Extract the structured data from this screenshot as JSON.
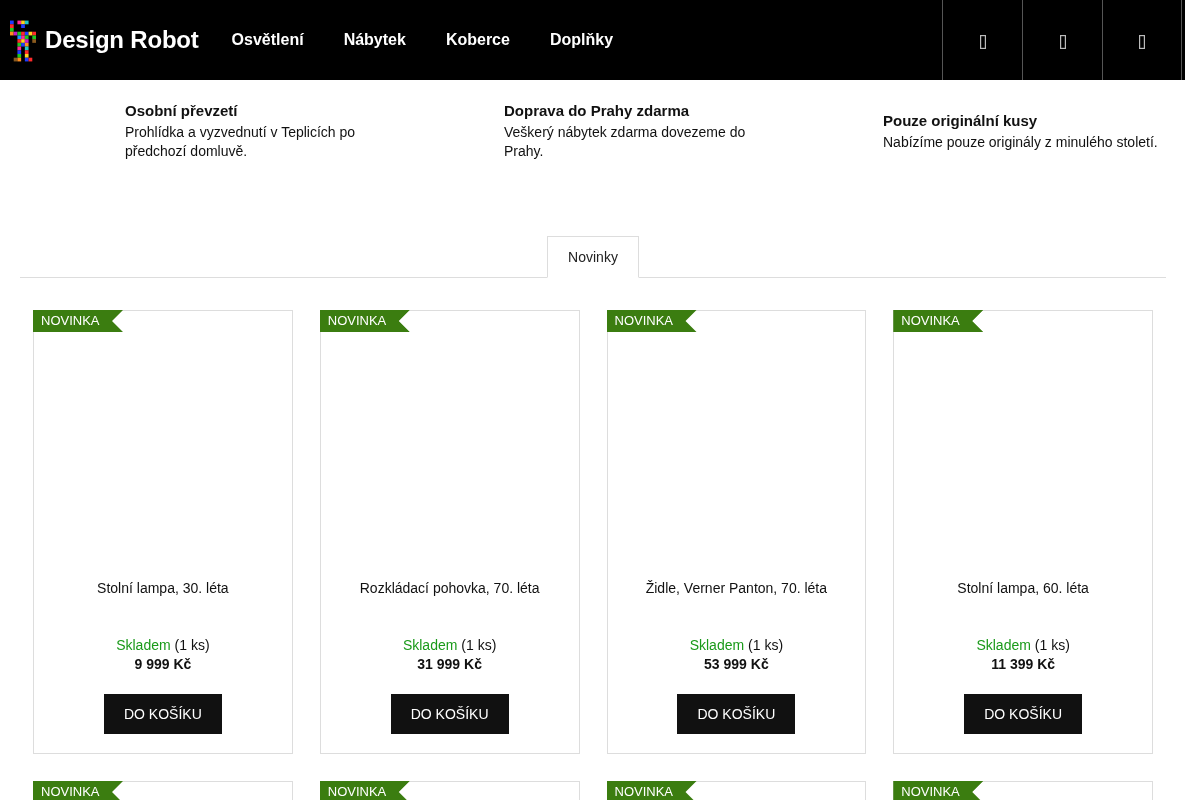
{
  "header": {
    "logo": "Design Robot",
    "nav": [
      "Osvětlení",
      "Nábytek",
      "Koberce",
      "Doplňky"
    ]
  },
  "benefits": [
    {
      "title": "Osobní převzetí",
      "text": "Prohlídka a vyzvednutí v Teplicích po předchozí domluvě."
    },
    {
      "title": "Doprava do Prahy zdarma",
      "text": "Veškerý nábytek zdarma dovezeme do Prahy."
    },
    {
      "title": "Pouze originální kusy",
      "text": "Nabízíme pouze originály z minulého století."
    }
  ],
  "tabs": [
    {
      "label": "Novinky",
      "selected": true
    }
  ],
  "products": [
    {
      "badge": "NOVINKA",
      "name": "Stolní lampa, 30. léta",
      "in_stock": true,
      "stock": "Skladem",
      "quantity": "(1 ks)",
      "price": "9 999 Kč",
      "button": "DO KOŠÍKU"
    },
    {
      "badge": "NOVINKA",
      "name": "Rozkládací pohovka, 70. léta",
      "in_stock": true,
      "stock": "Skladem",
      "quantity": "(1 ks)",
      "price": "31 999 Kč",
      "button": "DO KOŠÍKU"
    },
    {
      "badge": "NOVINKA",
      "name": "Židle, Verner Panton, 70. léta",
      "in_stock": true,
      "stock": "Skladem",
      "quantity": "(1 ks)",
      "price": "53 999 Kč",
      "button": "DO KOŠÍKU"
    },
    {
      "badge": "NOVINKA",
      "name": "Stolní lampa, 60. léta",
      "in_stock": true,
      "stock": "Skladem",
      "quantity": "(1 ks)",
      "price": "11 399 Kč",
      "button": "DO KOŠÍKU"
    },
    {
      "badge": "NOVINKA"
    },
    {
      "badge": "NOVINKA"
    },
    {
      "badge": "NOVINKA"
    },
    {
      "badge": "NOVINKA"
    }
  ]
}
